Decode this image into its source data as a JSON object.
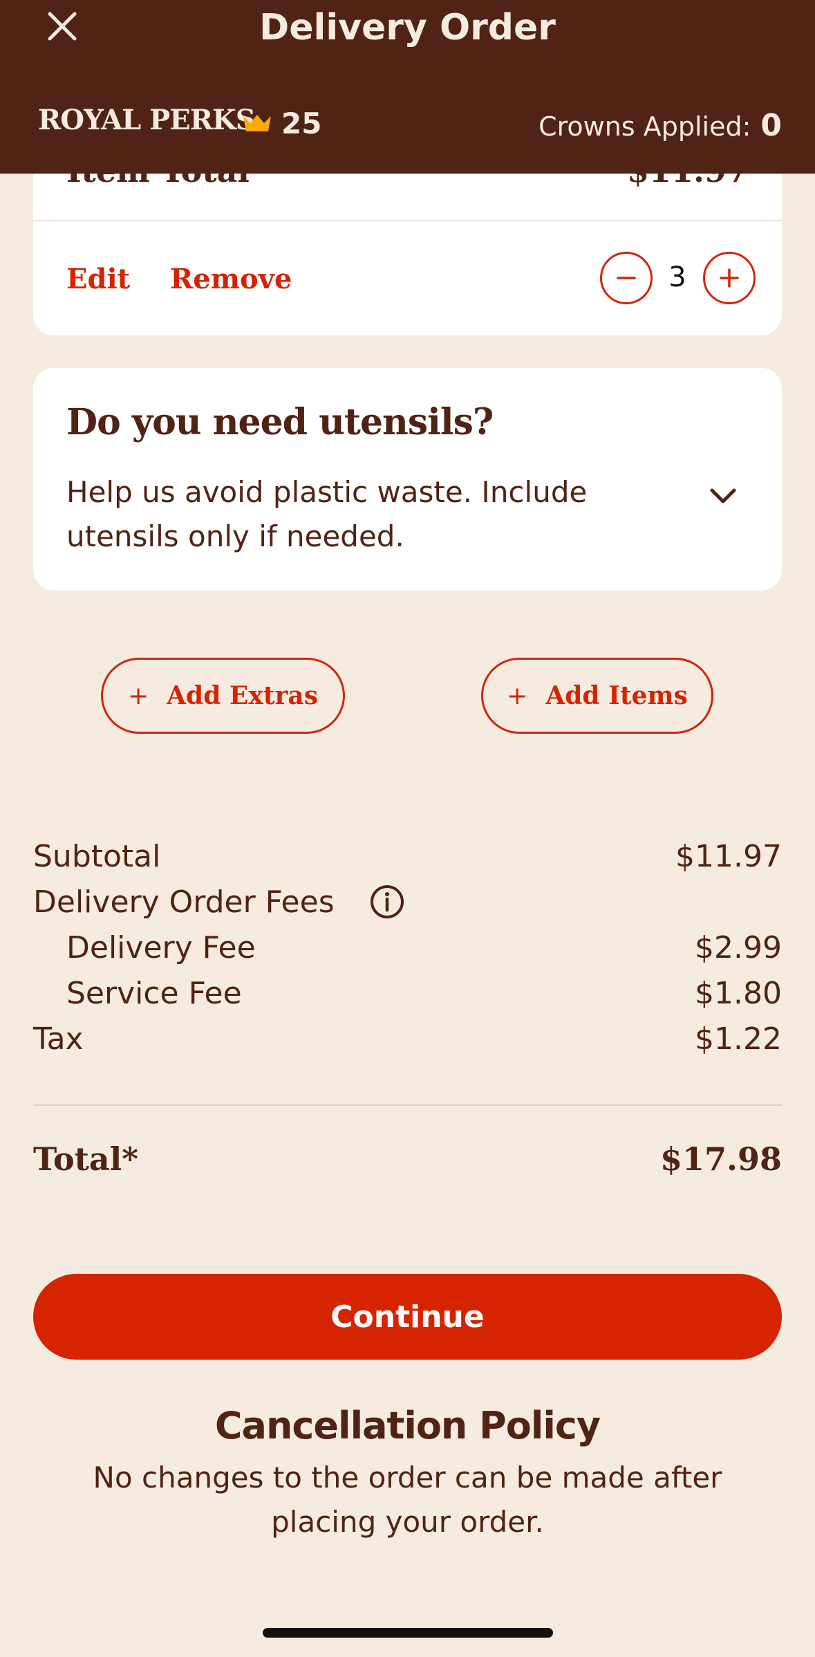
{
  "header": {
    "title": "Delivery Order",
    "logo_text": "ROYAL PERKS",
    "crown_count": "25",
    "crowns_applied_label": "Crowns Applied:",
    "crowns_applied_value": "0"
  },
  "item": {
    "total_label": "Item Total",
    "total_value": "$11.97",
    "edit_label": "Edit",
    "remove_label": "Remove",
    "quantity": "3"
  },
  "utensils": {
    "title": "Do you need utensils?",
    "description": "Help us avoid plastic waste. Include utensils only if needed."
  },
  "actions": {
    "add_extras": "Add Extras",
    "add_items": "Add Items",
    "plus_glyph": "+"
  },
  "summary": {
    "subtotal_label": "Subtotal",
    "subtotal_value": "$11.97",
    "fees_label": "Delivery Order Fees",
    "delivery_fee_label": "Delivery Fee",
    "delivery_fee_value": "$2.99",
    "service_fee_label": "Service Fee",
    "service_fee_value": "$1.80",
    "tax_label": "Tax",
    "tax_value": "$1.22",
    "total_label": "Total*",
    "total_value": "$17.98"
  },
  "continue_label": "Continue",
  "policy": {
    "title": "Cancellation Policy",
    "text": "No changes to the order can be made after placing your order."
  },
  "colors": {
    "brand_brown": "#502314",
    "accent_red": "#d62300",
    "background": "#f5ebe0",
    "crown_gold": "#ffaa00"
  },
  "icons": {
    "close": "close-icon",
    "crown": "crown-icon",
    "minus": "minus-icon",
    "plus": "plus-icon",
    "chevron": "chevron-down-icon",
    "info": "info-icon"
  }
}
